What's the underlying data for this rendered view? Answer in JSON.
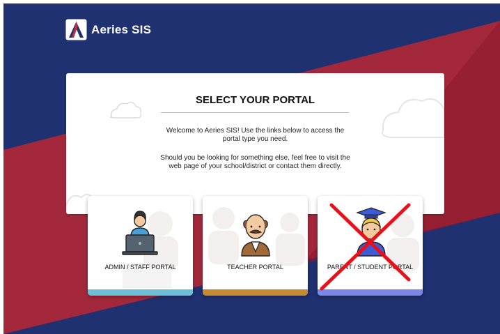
{
  "brand": {
    "name": "Aeries SIS",
    "logo_letter": "A",
    "colors": {
      "navy": "#1f3170",
      "red": "#b0233a",
      "white": "#ffffff"
    }
  },
  "panel": {
    "title": "SELECT YOUR PORTAL",
    "intro_line1": "Welcome to Aeries SIS! Use the links below to access the",
    "intro_line2": "portal type you need.",
    "intro_line3": "Should you be looking for something else, feel free to visit the",
    "intro_line4": "web page of your school/district or contact them directly."
  },
  "portals": [
    {
      "label": "ADMIN / STAFF PORTAL",
      "accent": "#6bbfd6",
      "icon": "admin-laptop-icon"
    },
    {
      "label": "TEACHER PORTAL",
      "accent": "#c58a2e",
      "icon": "teacher-icon"
    },
    {
      "label": "PARENT / STUDENT PORTAL",
      "accent": "#7c86e6",
      "icon": "student-graduate-icon",
      "crossed_out": true,
      "cross_color": "#e8101a"
    }
  ]
}
